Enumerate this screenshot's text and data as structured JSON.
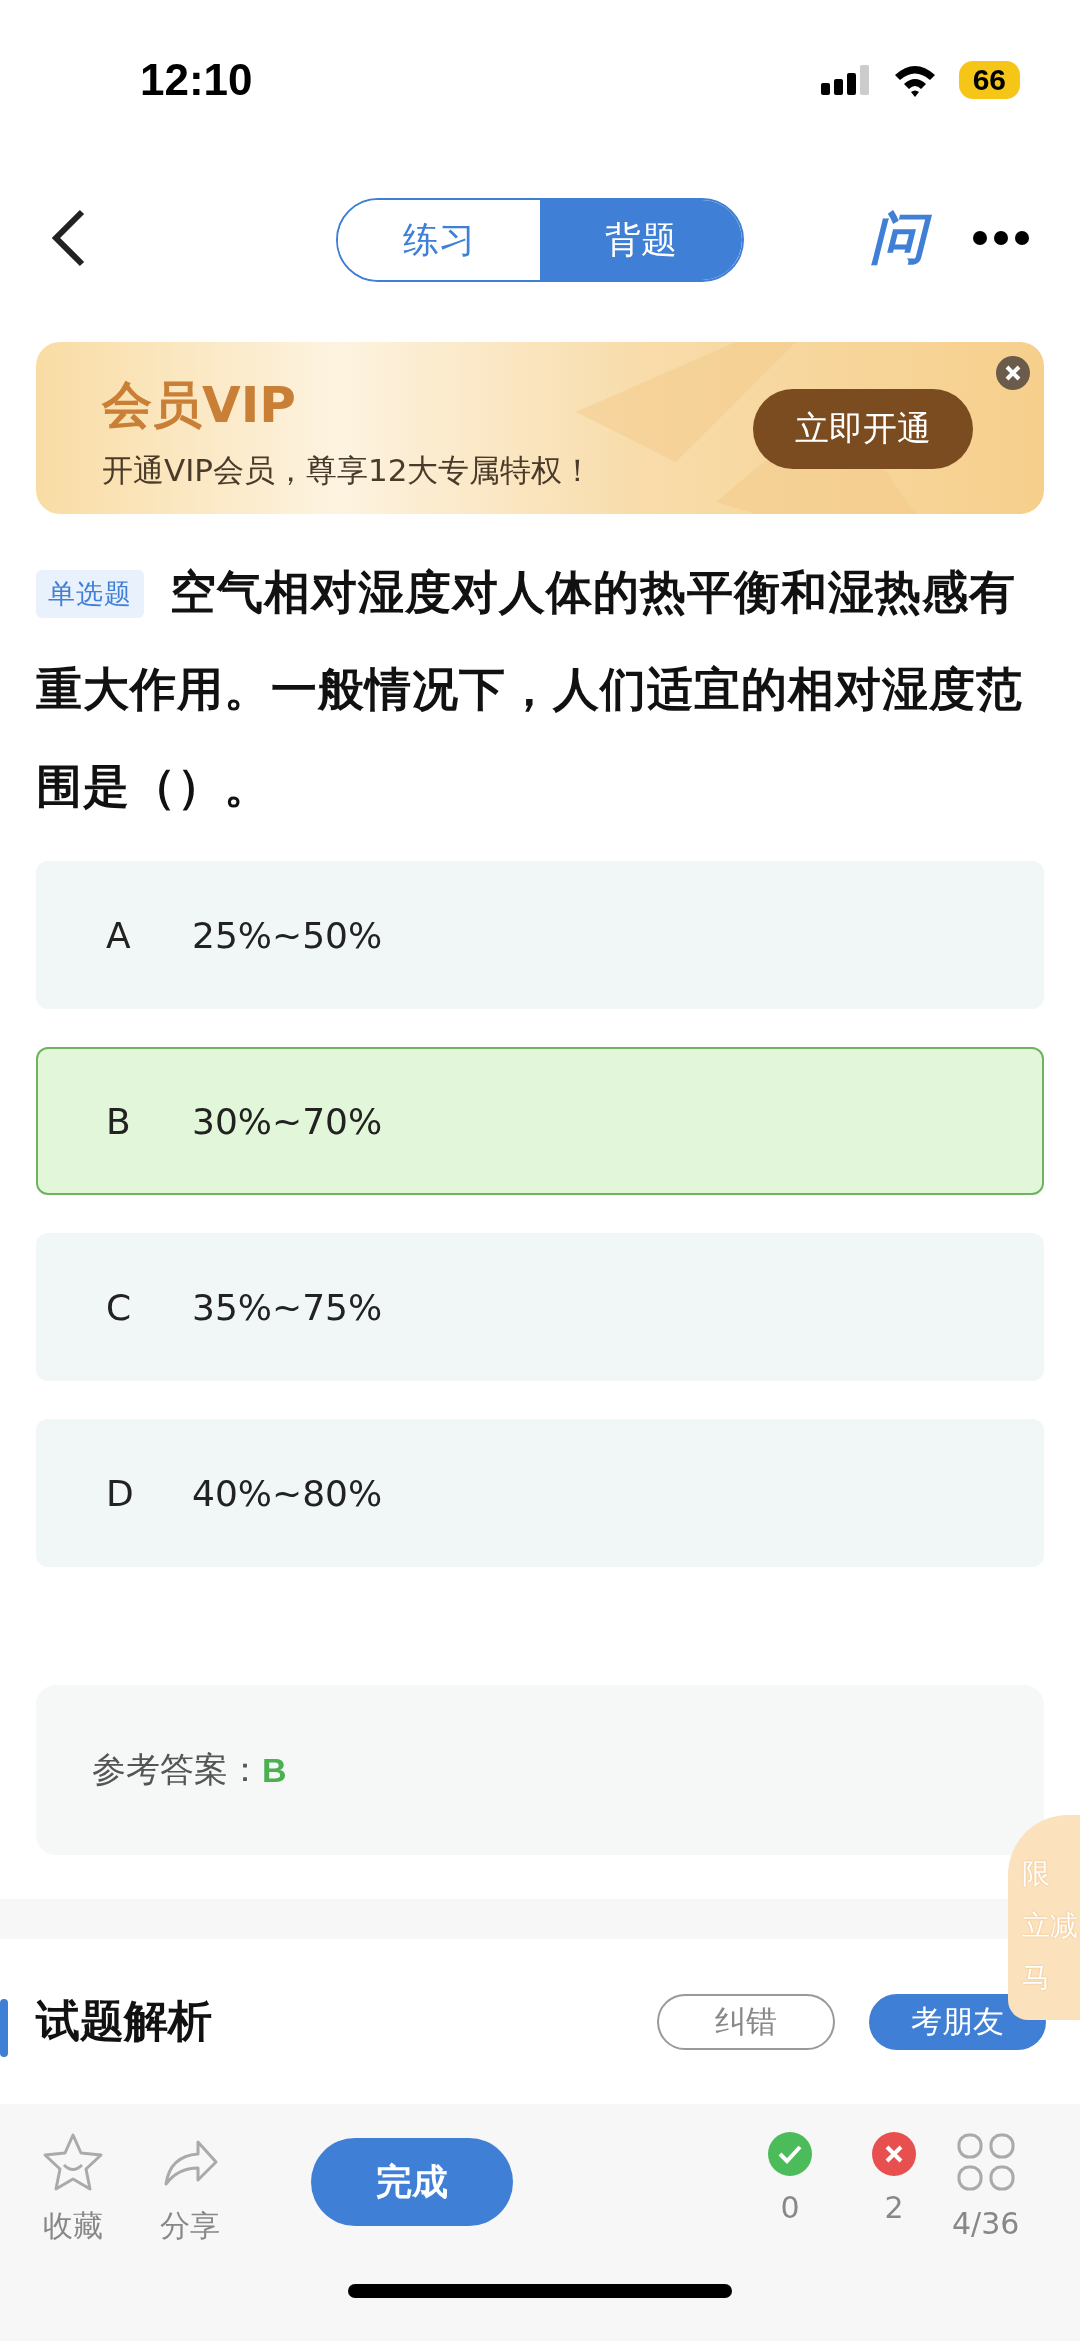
{
  "status_bar": {
    "time": "12:10",
    "battery": "66"
  },
  "header": {
    "tabs": [
      {
        "label": "练习",
        "selected": false
      },
      {
        "label": "背题",
        "selected": true
      }
    ],
    "ask_label": "问"
  },
  "vip_banner": {
    "title": "会员VIP",
    "subtitle": "开通VIP会员，尊享12大专属特权！",
    "button": "立即开通"
  },
  "question": {
    "type_tag": "单选题",
    "text": "空气相对湿度对人体的热平衡和湿热感有重大作用。一般情况下，人们适宜的相对湿度范围是（）。"
  },
  "options": [
    {
      "letter": "A",
      "text": "25%~50%",
      "selected": false
    },
    {
      "letter": "B",
      "text": "30%~70%",
      "selected": true
    },
    {
      "letter": "C",
      "text": "35%~75%",
      "selected": false
    },
    {
      "letter": "D",
      "text": "40%~80%",
      "selected": false
    }
  ],
  "answer": {
    "label": "参考答案：",
    "value": "B"
  },
  "promo": {
    "lines": [
      "限",
      "立减",
      "马"
    ]
  },
  "analysis": {
    "title": "试题解析",
    "buttons": [
      {
        "label": "纠错",
        "kind": "outline"
      },
      {
        "label": "考朋友",
        "kind": "filled"
      }
    ]
  },
  "bottom_bar": {
    "favorite": "收藏",
    "share": "分享",
    "done": "完成",
    "correct": "0",
    "wrong": "2",
    "progress": "4/36"
  }
}
